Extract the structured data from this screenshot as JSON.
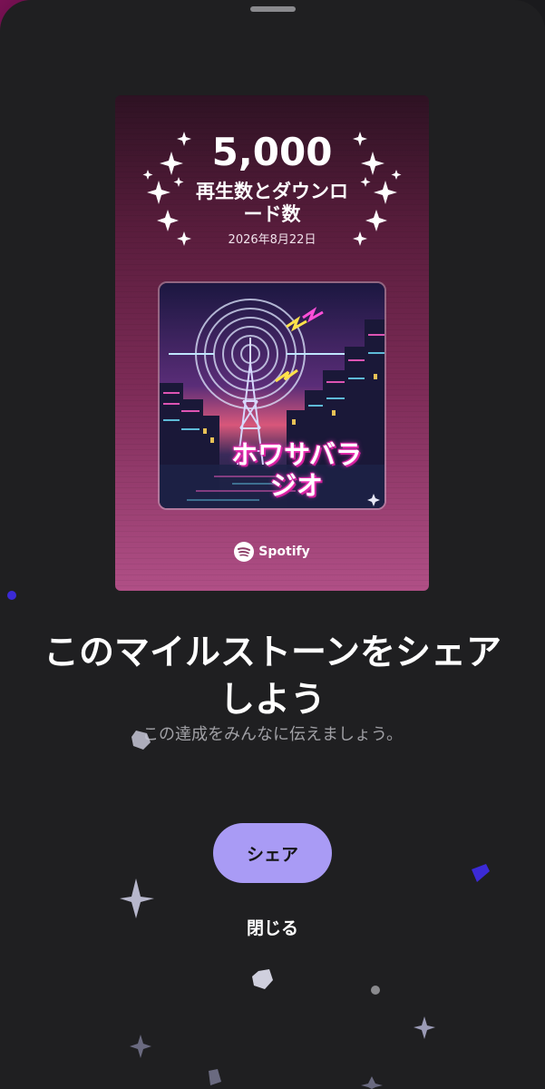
{
  "milestone": {
    "value": "5,000",
    "label": "再生数とダウンロード数",
    "date": "2026年8月22日"
  },
  "cover": {
    "title": "ホワサバラジオ"
  },
  "brand": {
    "name": "Spotify"
  },
  "dialog": {
    "headline": "このマイルストーンをシェアしよう",
    "subtext": "この達成をみんなに伝えましょう。",
    "share_label": "シェア",
    "close_label": "閉じる"
  },
  "colors": {
    "accent": "#a99bf5",
    "sheet_background": "#1f1f21",
    "card_gradient_top": "#2e1223",
    "card_gradient_bottom": "#b04f86"
  },
  "icons": [
    "sparkle-icon",
    "spotify-logo-icon",
    "grabber-handle"
  ]
}
